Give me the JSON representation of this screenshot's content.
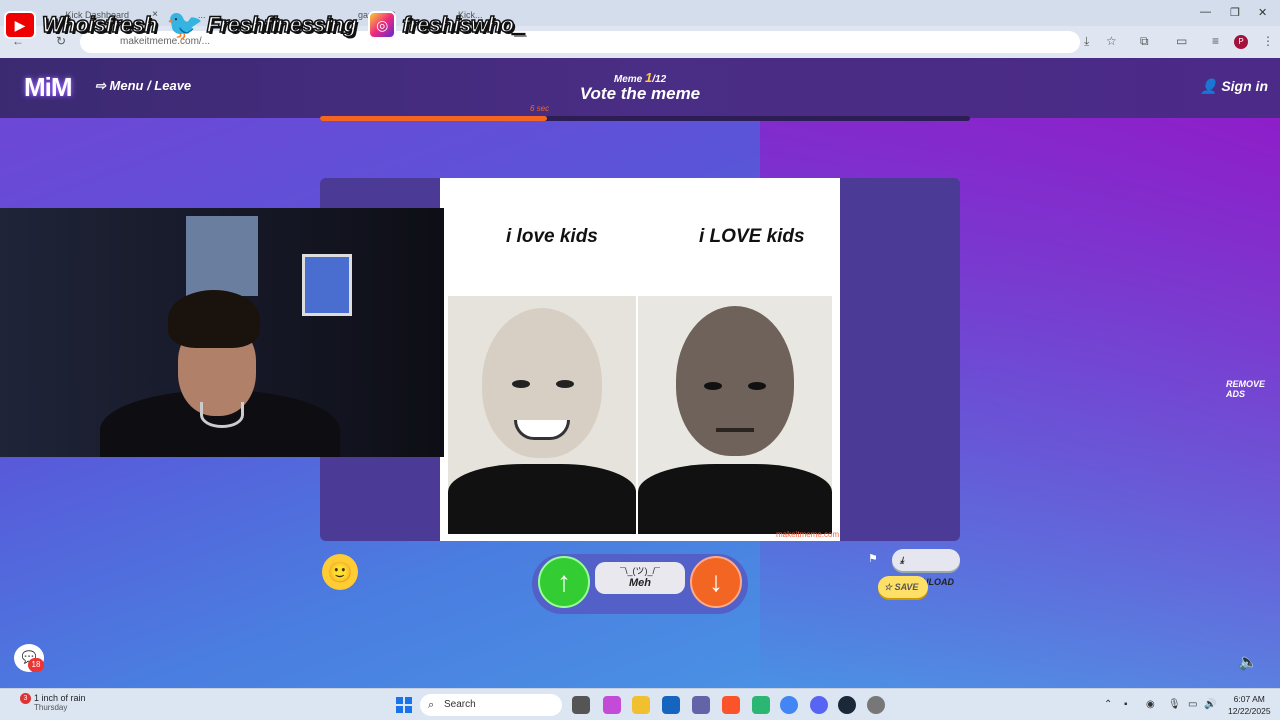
{
  "browser": {
    "tabs": [
      {
        "label": "...Kick Dashboard"
      },
      {
        "label": "..."
      },
      {
        "label": "game 1/2"
      },
      {
        "label": "Kick..."
      }
    ],
    "url": "makeitmeme.com/..."
  },
  "overlay": {
    "youtube": "Whoisfresh",
    "twitter": "Freshfinessing",
    "instagram": "freshiswho_"
  },
  "header": {
    "logo": "MiM",
    "menu_leave": "Menu / Leave",
    "meme_prefix": "Meme",
    "meme_current": "1",
    "meme_total": "/12",
    "phase": "Vote the meme",
    "sign_in": "Sign in",
    "timer_label": "6 sec",
    "timer_progress": 0.35
  },
  "meme": {
    "left_caption": "i love kids",
    "right_caption": "i LOVE kids",
    "watermark": "makeitmeme.com"
  },
  "controls": {
    "meh_face": "¯\\_(ツ)_/¯",
    "meh_label": "Meh",
    "download": "DOWNLOAD",
    "save": "SAVE",
    "remove_ads": "REMOVE ADS",
    "chat_badge": "18"
  },
  "taskbar": {
    "weather_badge": "3",
    "weather_title": "1 inch of rain",
    "weather_day": "Thursday",
    "search": "Search",
    "time": "6:07 AM",
    "date": "12/22/2025"
  },
  "colors": {
    "accent_orange": "#f26522",
    "vote_up": "#33cc33",
    "header_bg": "#3b2a72"
  }
}
